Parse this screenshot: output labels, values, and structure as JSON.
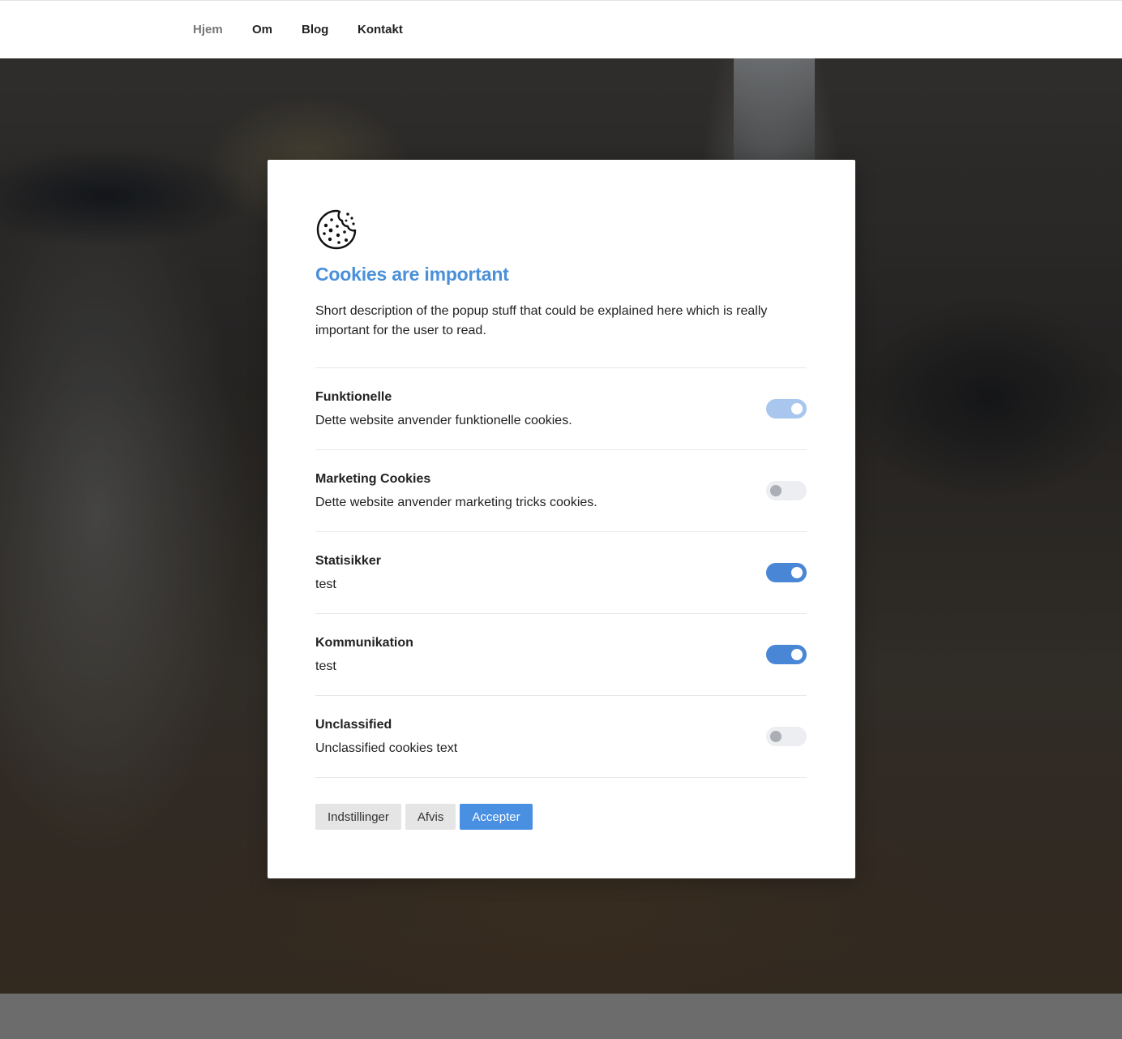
{
  "nav": {
    "items": [
      {
        "label": "Hjem",
        "active": true
      },
      {
        "label": "Om"
      },
      {
        "label": "Blog"
      },
      {
        "label": "Kontakt"
      }
    ]
  },
  "modal": {
    "icon": "cookie-icon",
    "title": "Cookies are important",
    "description": "Short description of the popup stuff that could be explained here which is really important for the user to read.",
    "categories": [
      {
        "title": "Funktionelle",
        "description": "Dette website anvender funktionelle cookies.",
        "enabled": true,
        "disabled_state": true
      },
      {
        "title": "Marketing Cookies",
        "description": "Dette website anvender marketing tricks cookies.",
        "enabled": false
      },
      {
        "title": "Statisikker",
        "description": "test",
        "enabled": true
      },
      {
        "title": "Kommunikation",
        "description": "test",
        "enabled": true
      },
      {
        "title": "Unclassified",
        "description": "Unclassified cookies text",
        "enabled": false
      }
    ],
    "buttons": {
      "settings": "Indstillinger",
      "reject": "Afvis",
      "accept": "Accepter"
    }
  },
  "colors": {
    "accent": "#4a90d9",
    "toggle_on": "#4a86d6",
    "toggle_on_light": "#a8c6ee",
    "toggle_off": "#edeef1"
  }
}
